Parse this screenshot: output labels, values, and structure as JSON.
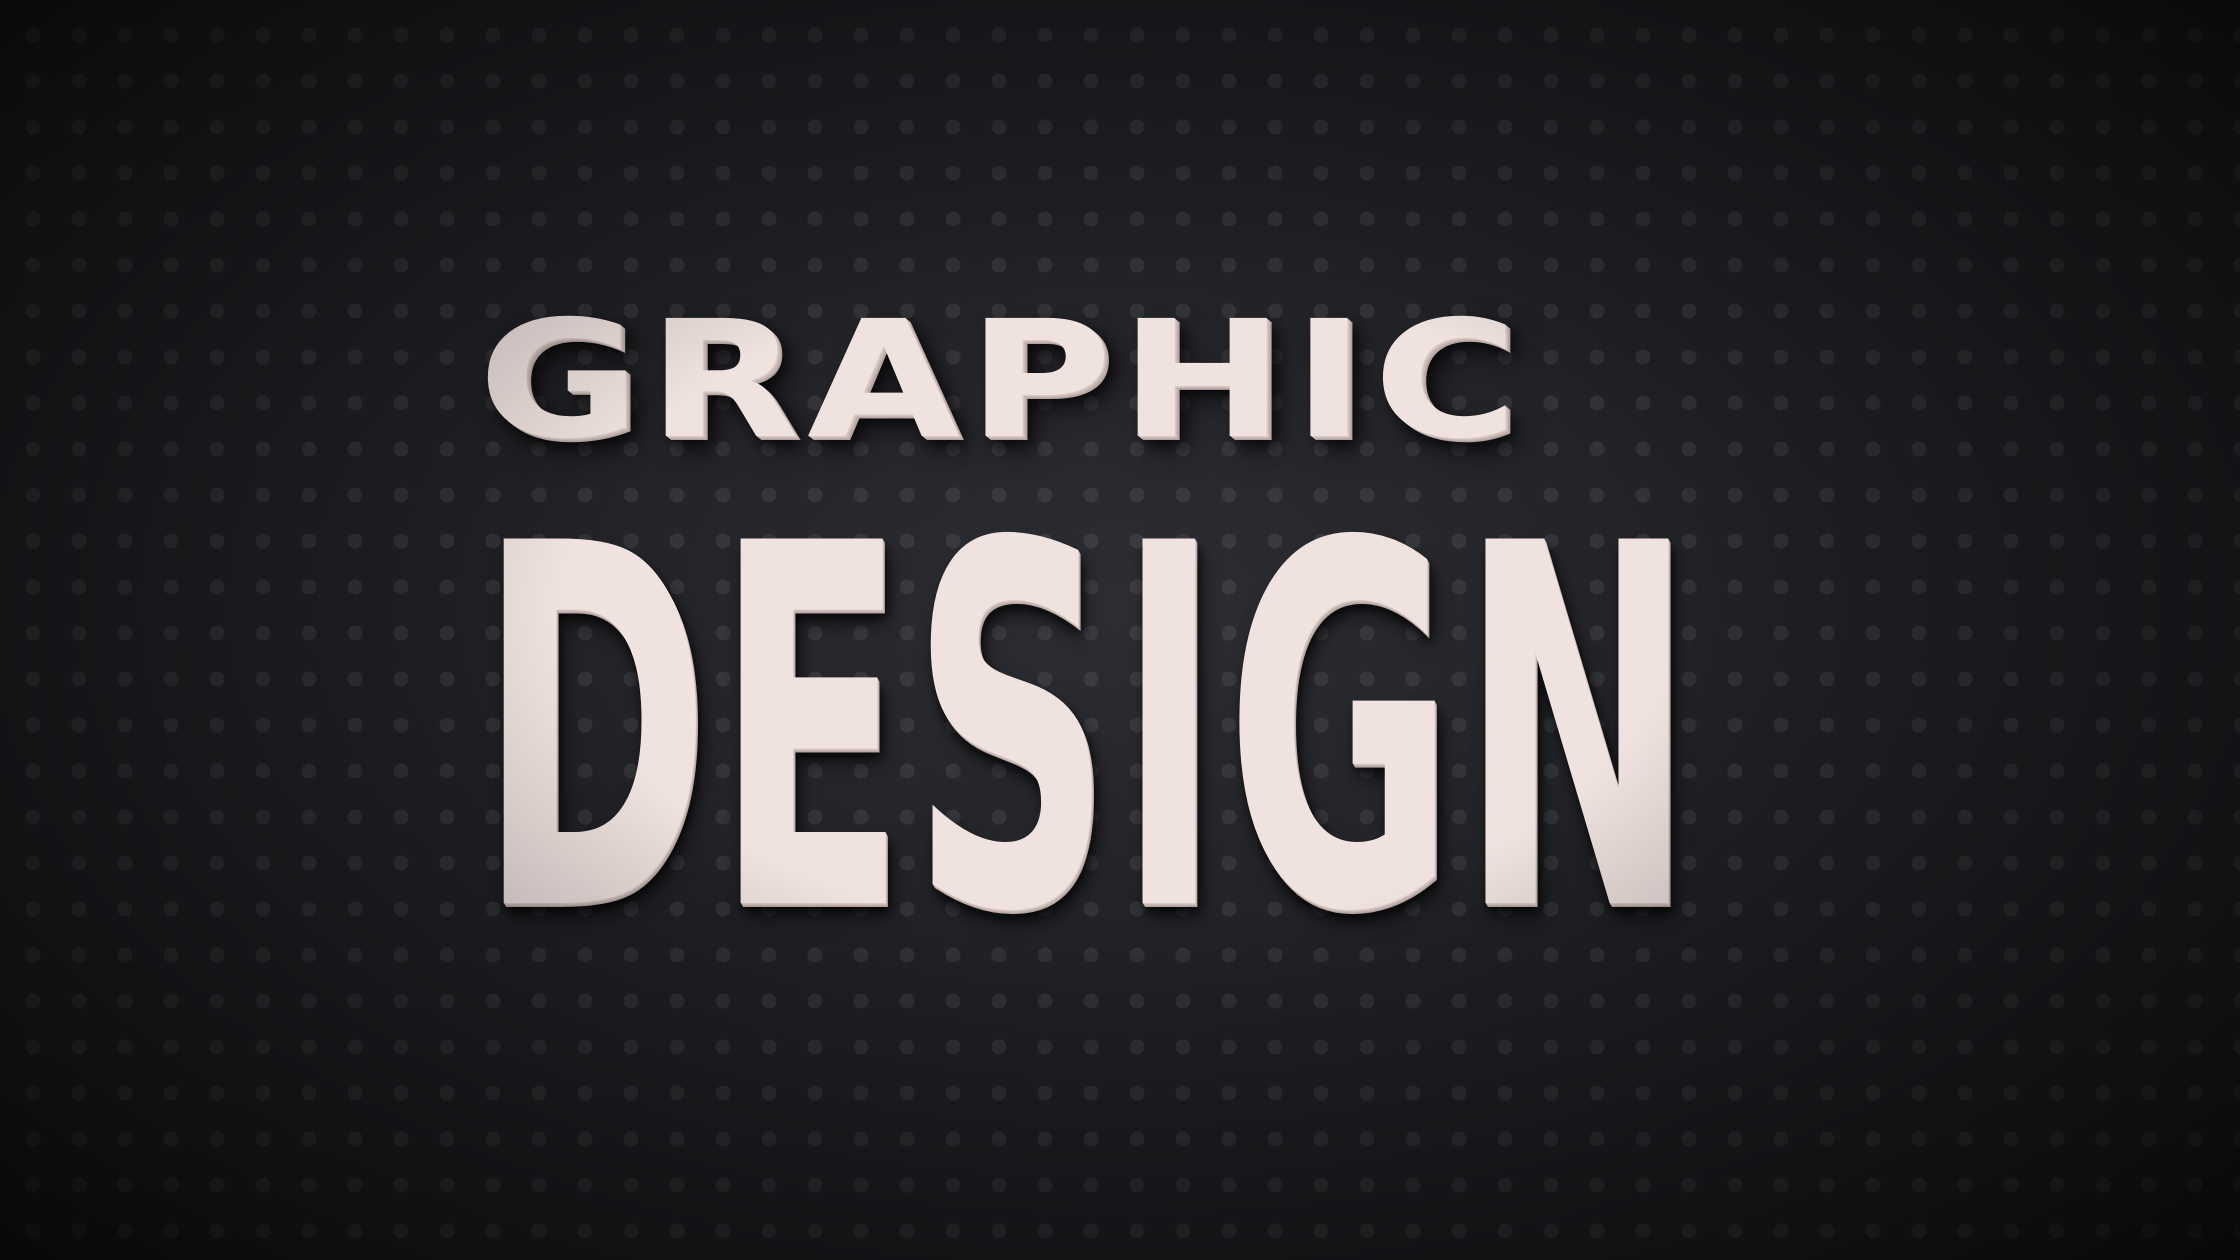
{
  "photo": {
    "line1": "GRAPHIC",
    "line2": "DESIGN",
    "background_color": "#1f2024",
    "letter_color": "#efe2df"
  }
}
